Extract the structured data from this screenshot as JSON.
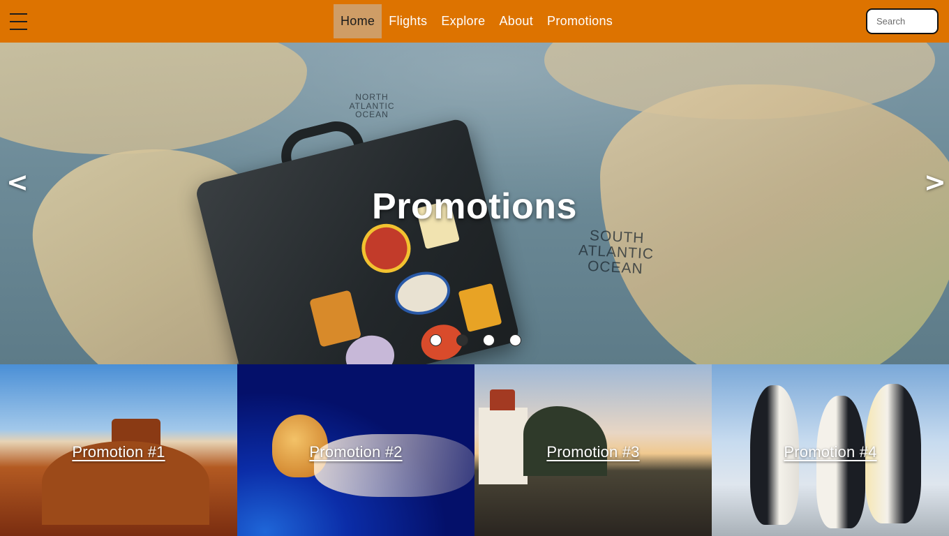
{
  "nav": {
    "links": [
      {
        "label": "Home",
        "active": true
      },
      {
        "label": "Flights",
        "active": false
      },
      {
        "label": "Explore",
        "active": false
      },
      {
        "label": "About",
        "active": false
      },
      {
        "label": "Promotions",
        "active": false
      }
    ],
    "search_placeholder": "Search",
    "menu_icon": "hamburger-menu-icon"
  },
  "hero": {
    "title": "Promotions",
    "prev_arrow": "<",
    "next_arrow": ">",
    "ocean_labels": [
      "NORTH ATLANTIC OCEAN",
      "SOUTH ATLANTIC OCEAN"
    ],
    "slides_count": 4,
    "active_slide": 2
  },
  "promotions": [
    {
      "label": "Promotion #1",
      "scene": "desert"
    },
    {
      "label": "Promotion #2",
      "scene": "jellyfish"
    },
    {
      "label": "Promotion #3",
      "scene": "lighthouse"
    },
    {
      "label": "Promotion #4",
      "scene": "penguins"
    }
  ],
  "colors": {
    "nav_bg": "#dd7300",
    "nav_active_bg": "#cf9d66",
    "text_light": "#ffffff"
  }
}
